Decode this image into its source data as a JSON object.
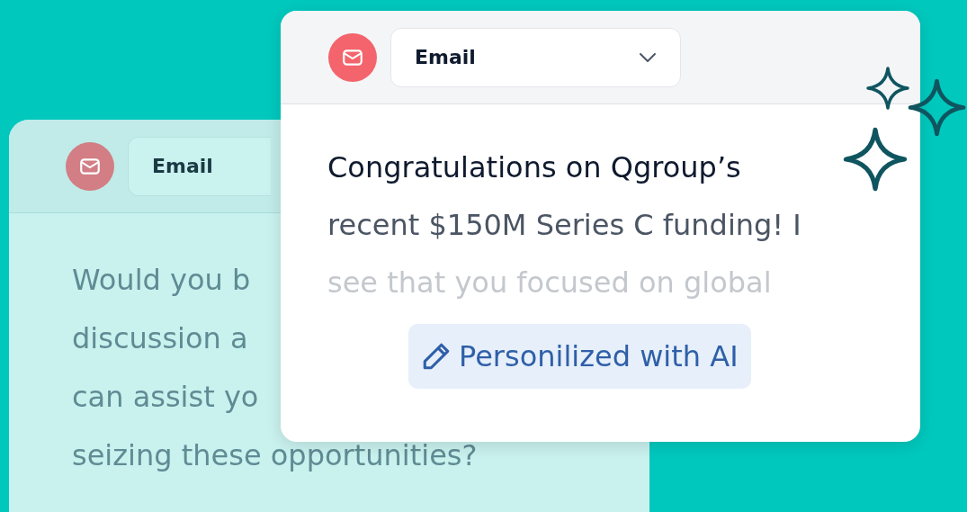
{
  "back_card": {
    "channel": {
      "value": "Email"
    },
    "lines": [
      "Would you b",
      "discussion a",
      "can assist yo",
      "seizing these opportunities?"
    ]
  },
  "front_card": {
    "channel": {
      "value": "Email"
    },
    "lines": [
      "Congratulations on Qgroup’s",
      "recent $150M Series C funding! I",
      "see that you focused on global"
    ],
    "badge": "Personilized with AI"
  }
}
